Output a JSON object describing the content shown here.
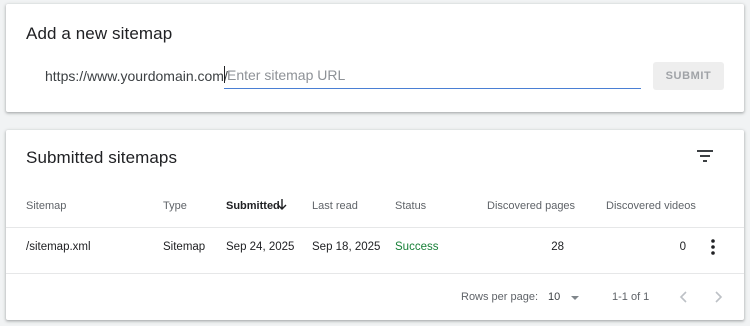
{
  "add_sitemap": {
    "title": "Add a new sitemap",
    "url_prefix": "https://www.yourdomain.com/",
    "input_value": "",
    "input_placeholder": "Enter sitemap URL",
    "submit_label": "SUBMIT"
  },
  "submitted": {
    "title": "Submitted sitemaps",
    "filter_icon": "filter-list-icon",
    "columns": {
      "sitemap": "Sitemap",
      "type": "Type",
      "submitted": "Submitted",
      "last_read": "Last read",
      "status": "Status",
      "discovered_pages": "Discovered pages",
      "discovered_videos": "Discovered videos"
    },
    "sort": {
      "column": "submitted",
      "direction": "descending",
      "icon": "arrow-down-icon"
    },
    "rows": [
      {
        "sitemap": "/sitemap.xml",
        "type": "Sitemap",
        "submitted": "Sep 24, 2025",
        "last_read": "Sep 18, 2025",
        "status": "Success",
        "discovered_pages": "28",
        "discovered_videos": "0"
      }
    ],
    "footer": {
      "rows_per_page_label": "Rows per page:",
      "rows_per_page_value": "10",
      "range": "1-1 of 1"
    }
  },
  "colors": {
    "background": "#f1f3f4",
    "input_underline": "#4a7fd4",
    "success": "#188038",
    "muted_text": "#5f6368"
  }
}
